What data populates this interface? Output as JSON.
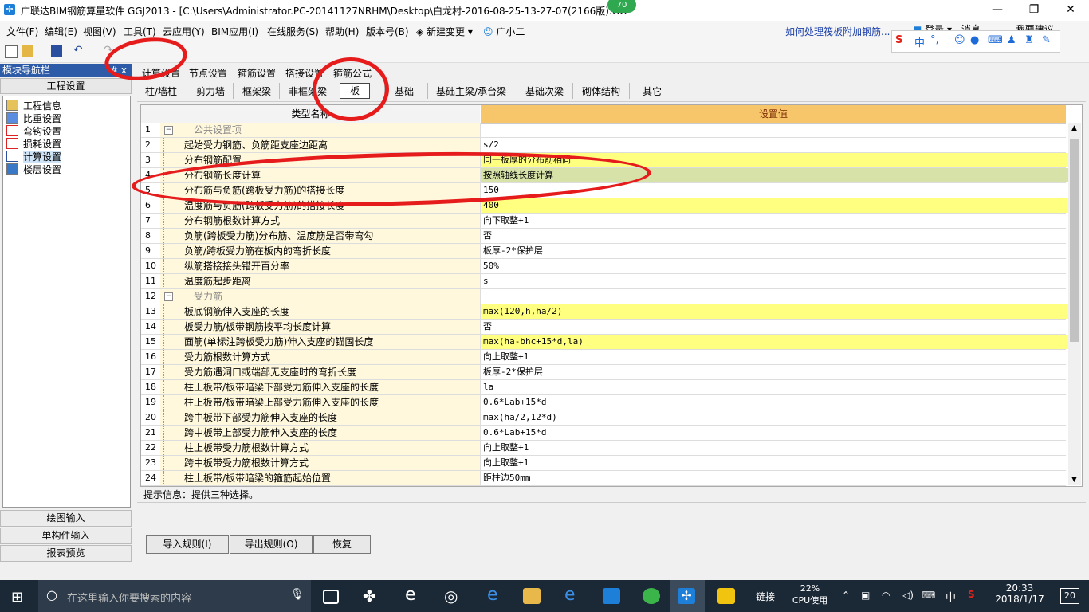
{
  "window": {
    "title": "广联达BIM钢筋算量软件 GGJ2013 - [C:\\Users\\Administrator.PC-20141127NRHM\\Desktop\\白龙村-2016-08-25-13-27-07(2166版).GG",
    "badge": "70",
    "controls": {
      "minimize": "—",
      "restore": "❐",
      "close": "✕"
    }
  },
  "menu": {
    "items": [
      "文件(F)",
      "编辑(E)",
      "视图(V)",
      "工具(T)",
      "云应用(Y)",
      "BIM应用(I)",
      "在线服务(S)",
      "帮助(H)",
      "版本号(B)",
      "新建变更",
      "广小二"
    ],
    "help_link": "如何处理筏板附加钢筋...",
    "login": "登录",
    "messages": "消息",
    "suggest": "我要建议"
  },
  "ime": {
    "label": "中",
    "punct": "°,"
  },
  "nav": {
    "header": "模块导航栏",
    "pin": "#  x",
    "section": "工程设置",
    "items": [
      "工程信息",
      "比重设置",
      "弯钩设置",
      "损耗设置",
      "计算设置",
      "楼层设置"
    ],
    "bottom_buttons": [
      "绘图输入",
      "单构件输入",
      "报表预览"
    ]
  },
  "main_tabs": [
    "计算设置",
    "节点设置",
    "箍筋设置",
    "搭接设置",
    "箍筋公式"
  ],
  "sub_tabs": [
    "柱/墙柱",
    "剪力墙",
    "框架梁",
    "非框架梁",
    "板",
    "基础",
    "基础主梁/承台梁",
    "基础次梁",
    "砌体结构",
    "其它"
  ],
  "grid": {
    "col_name": "类型名称",
    "col_value": "设置值",
    "rows": [
      {
        "n": "1",
        "name": "公共设置项",
        "value": "",
        "group": true,
        "style": ""
      },
      {
        "n": "2",
        "name": "起始受力钢筋、负筋距支座边距离",
        "value": "s/2",
        "style": ""
      },
      {
        "n": "3",
        "name": "分布钢筋配置",
        "value": "同一板厚的分布筋相同",
        "style": "ylw"
      },
      {
        "n": "4",
        "name": "分布钢筋长度计算",
        "value": "按照轴线长度计算",
        "style": "sel"
      },
      {
        "n": "5",
        "name": "分布筋与负筋(跨板受力筋)的搭接长度",
        "value": "150",
        "style": ""
      },
      {
        "n": "6",
        "name": "温度筋与负筋(跨板受力筋)的搭接长度",
        "value": "400",
        "style": "ylw"
      },
      {
        "n": "7",
        "name": "分布钢筋根数计算方式",
        "value": "向下取整+1",
        "style": ""
      },
      {
        "n": "8",
        "name": "负筋(跨板受力筋)分布筋、温度筋是否带弯勾",
        "value": "否",
        "style": ""
      },
      {
        "n": "9",
        "name": "负筋/跨板受力筋在板内的弯折长度",
        "value": "板厚-2*保护层",
        "style": ""
      },
      {
        "n": "10",
        "name": "纵筋搭接接头错开百分率",
        "value": "50%",
        "style": ""
      },
      {
        "n": "11",
        "name": "温度筋起步距离",
        "value": "s",
        "style": ""
      },
      {
        "n": "12",
        "name": "受力筋",
        "value": "",
        "group": true,
        "style": ""
      },
      {
        "n": "13",
        "name": "板底钢筋伸入支座的长度",
        "value": "max(120,h,ha/2)",
        "style": "ylw"
      },
      {
        "n": "14",
        "name": "板受力筋/板带钢筋按平均长度计算",
        "value": "否",
        "style": ""
      },
      {
        "n": "15",
        "name": "面筋(单标注跨板受力筋)伸入支座的锚固长度",
        "value": "max(ha-bhc+15*d,la)",
        "style": "ylw"
      },
      {
        "n": "16",
        "name": "受力筋根数计算方式",
        "value": "向上取整+1",
        "style": ""
      },
      {
        "n": "17",
        "name": "受力筋遇洞口或端部无支座时的弯折长度",
        "value": "板厚-2*保护层",
        "style": ""
      },
      {
        "n": "18",
        "name": "柱上板带/板带暗梁下部受力筋伸入支座的长度",
        "value": "la",
        "style": ""
      },
      {
        "n": "19",
        "name": "柱上板带/板带暗梁上部受力筋伸入支座的长度",
        "value": "0.6*Lab+15*d",
        "style": ""
      },
      {
        "n": "20",
        "name": "跨中板带下部受力筋伸入支座的长度",
        "value": "max(ha/2,12*d)",
        "style": ""
      },
      {
        "n": "21",
        "name": "跨中板带上部受力筋伸入支座的长度",
        "value": "0.6*Lab+15*d",
        "style": ""
      },
      {
        "n": "22",
        "name": "柱上板带受力筋根数计算方式",
        "value": "向上取整+1",
        "style": ""
      },
      {
        "n": "23",
        "name": "跨中板带受力筋根数计算方式",
        "value": "向上取整+1",
        "style": ""
      },
      {
        "n": "24",
        "name": "柱上板带/板带暗梁的箍筋起始位置",
        "value": "距柱边50mm",
        "style": ""
      }
    ]
  },
  "hint": "提示信息：提供三种选择。",
  "buttons": {
    "import": "导入规则(I)",
    "export": "导出规则(O)",
    "restore": "恢复"
  },
  "taskbar": {
    "search_placeholder": "在这里输入你要搜索的内容",
    "network": "链接",
    "cpu_pct": "22%",
    "cpu_label": "CPU使用",
    "ime": "中",
    "time": "20:33",
    "date": "2018/1/17",
    "notif_count": "20"
  },
  "colors": {
    "annotation_red": "#e61b1b",
    "highlight_yellow": "#ffff80",
    "selected_row": "#d6e2a8",
    "nav_header": "#2d5ba8"
  }
}
